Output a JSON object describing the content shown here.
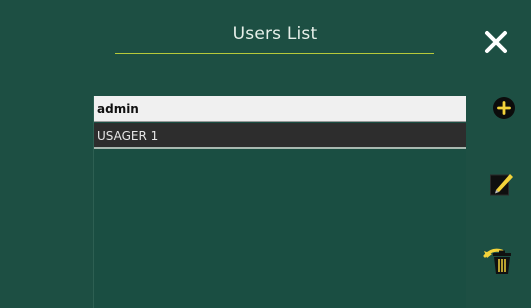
{
  "header": {
    "title": "Users List"
  },
  "toolbar": {
    "close_icon": "close-icon",
    "add_icon": "add-user-icon",
    "edit_icon": "edit-user-icon",
    "delete_icon": "delete-user-icon"
  },
  "users": [
    {
      "name": "admin",
      "selected": true
    },
    {
      "name": "USAGER 1",
      "selected": false
    }
  ],
  "colors": {
    "background": "#1d4f43",
    "accent_line": "#b7c93a",
    "selected_row": "#f0f0f0",
    "row": "#2d2d2d",
    "edit_icon_accent": "#f3d33a",
    "delete_icon_accent": "#f3d33a"
  }
}
